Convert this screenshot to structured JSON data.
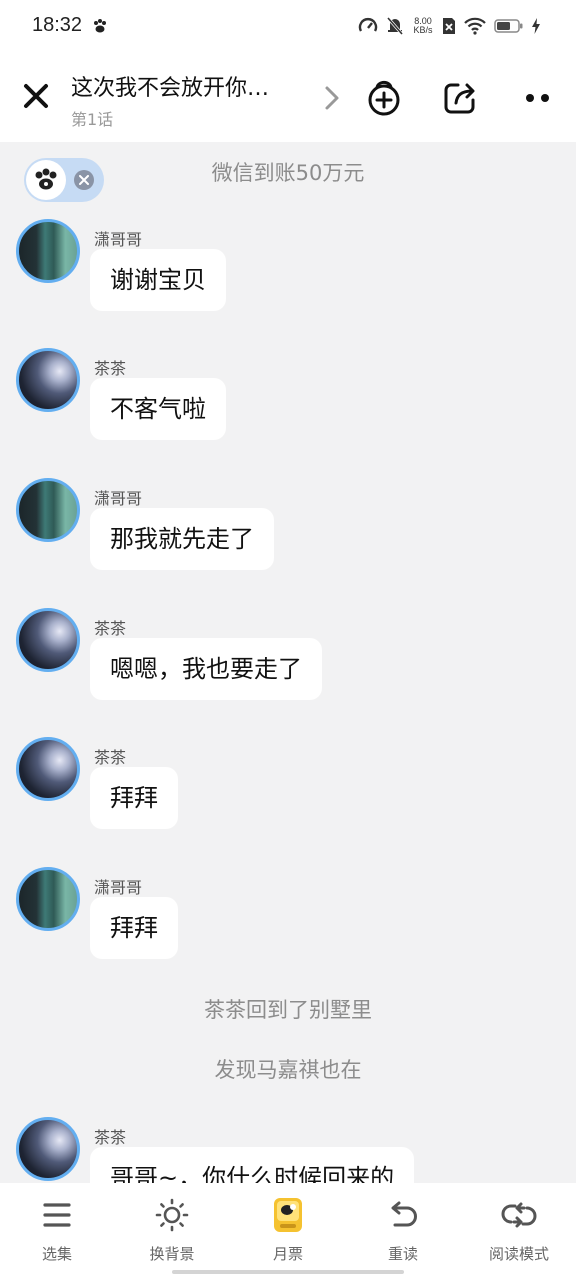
{
  "status_bar": {
    "time": "18:32",
    "net_speed_value": "8.00",
    "net_speed_unit": "KB/s",
    "battery_percent": 60
  },
  "header": {
    "title": "这次我不会放开你…",
    "episode": "第1话"
  },
  "chat": {
    "top_system": "微信到账50万元",
    "messages": [
      {
        "name": "潇哥哥",
        "text": "谢谢宝贝"
      },
      {
        "name": "茶茶",
        "text": "不客气啦"
      },
      {
        "name": "潇哥哥",
        "text": "那我就先走了"
      },
      {
        "name": "茶茶",
        "text": "嗯嗯，我也要走了"
      },
      {
        "name": "茶茶",
        "text": "拜拜"
      },
      {
        "name": "潇哥哥",
        "text": "拜拜"
      }
    ],
    "system_1": "茶茶回到了别墅里",
    "system_2": "发现马嘉祺也在",
    "last_message": {
      "name": "茶茶",
      "text": "哥哥~，你什么时候回来的"
    }
  },
  "bottom_tabs": [
    {
      "label": "选集",
      "icon": "menu-icon"
    },
    {
      "label": "换背景",
      "icon": "sun-icon"
    },
    {
      "label": "月票",
      "icon": "ticket-icon"
    },
    {
      "label": "重读",
      "icon": "undo-icon"
    },
    {
      "label": "阅读模式",
      "icon": "loop-icon"
    }
  ],
  "colors": {
    "background": "#f2f2f3",
    "avatar_ring": "#63aef0",
    "badge": "#c6dbf4",
    "ticket": "#f5c230"
  }
}
